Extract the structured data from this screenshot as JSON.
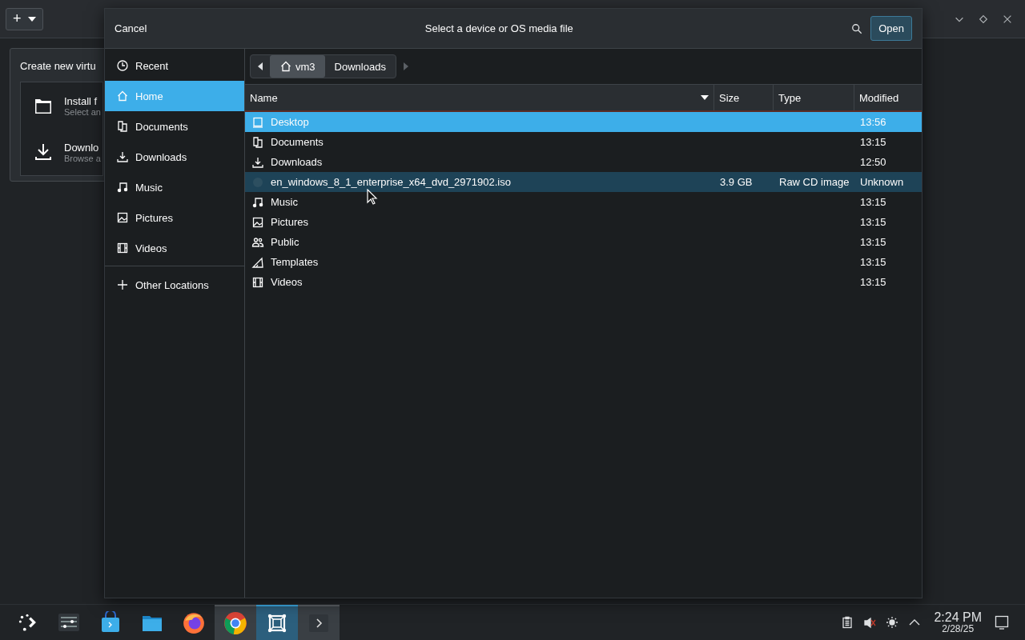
{
  "background_window": {
    "add_button": {
      "label": "+"
    },
    "popover": {
      "title": "Create new virtu",
      "options": [
        {
          "kind": "folder",
          "title": "Install f",
          "subtitle": "Select an"
        },
        {
          "kind": "download",
          "title": "Downlo",
          "subtitle": "Browse a"
        }
      ]
    }
  },
  "dialog": {
    "cancel": "Cancel",
    "title": "Select a device or OS media file",
    "open": "Open",
    "sidebar": [
      {
        "kind": "recent",
        "label": "Recent",
        "selected": false
      },
      {
        "kind": "home",
        "label": "Home",
        "selected": true
      },
      {
        "kind": "documents",
        "label": "Documents",
        "selected": false
      },
      {
        "kind": "downloads",
        "label": "Downloads",
        "selected": false
      },
      {
        "kind": "music",
        "label": "Music",
        "selected": false
      },
      {
        "kind": "pictures",
        "label": "Pictures",
        "selected": false
      },
      {
        "kind": "videos",
        "label": "Videos",
        "selected": false
      },
      {
        "kind": "other",
        "label": "Other Locations",
        "selected": false
      }
    ],
    "path": [
      {
        "label": "vm3",
        "home": true,
        "selected": true
      },
      {
        "label": "Downloads",
        "home": false,
        "selected": false
      }
    ],
    "columns": [
      "Name",
      "Size",
      "Type",
      "Modified"
    ],
    "rows": [
      {
        "kind": "desktop",
        "name": "Desktop",
        "size": "",
        "type": "",
        "modified": "13:56",
        "selected": true,
        "hovered": false
      },
      {
        "kind": "documents",
        "name": "Documents",
        "size": "",
        "type": "",
        "modified": "13:15",
        "selected": false,
        "hovered": false
      },
      {
        "kind": "downloads",
        "name": "Downloads",
        "size": "",
        "type": "",
        "modified": "12:50",
        "selected": false,
        "hovered": false
      },
      {
        "kind": "file",
        "name": "en_windows_8_1_enterprise_x64_dvd_2971902.iso",
        "size": "3.9 GB",
        "type": "Raw CD image",
        "modified": "Unknown",
        "selected": false,
        "hovered": true
      },
      {
        "kind": "music",
        "name": "Music",
        "size": "",
        "type": "",
        "modified": "13:15",
        "selected": false,
        "hovered": false
      },
      {
        "kind": "pictures",
        "name": "Pictures",
        "size": "",
        "type": "",
        "modified": "13:15",
        "selected": false,
        "hovered": false
      },
      {
        "kind": "public",
        "name": "Public",
        "size": "",
        "type": "",
        "modified": "13:15",
        "selected": false,
        "hovered": false
      },
      {
        "kind": "templates",
        "name": "Templates",
        "size": "",
        "type": "",
        "modified": "13:15",
        "selected": false,
        "hovered": false
      },
      {
        "kind": "videos",
        "name": "Videos",
        "size": "",
        "type": "",
        "modified": "13:15",
        "selected": false,
        "hovered": false
      }
    ]
  },
  "taskbar": {
    "apps": [
      {
        "kind": "launcher",
        "open": false,
        "active": false
      },
      {
        "kind": "settings",
        "open": false,
        "active": false
      },
      {
        "kind": "store",
        "open": false,
        "active": false
      },
      {
        "kind": "files",
        "open": false,
        "active": false
      },
      {
        "kind": "firefox",
        "open": false,
        "active": false
      },
      {
        "kind": "chrome",
        "open": true,
        "active": false
      },
      {
        "kind": "vm",
        "open": true,
        "active": true
      },
      {
        "kind": "terminal",
        "open": true,
        "active": false
      }
    ],
    "time": "2:24 PM",
    "date": "2/28/25"
  }
}
